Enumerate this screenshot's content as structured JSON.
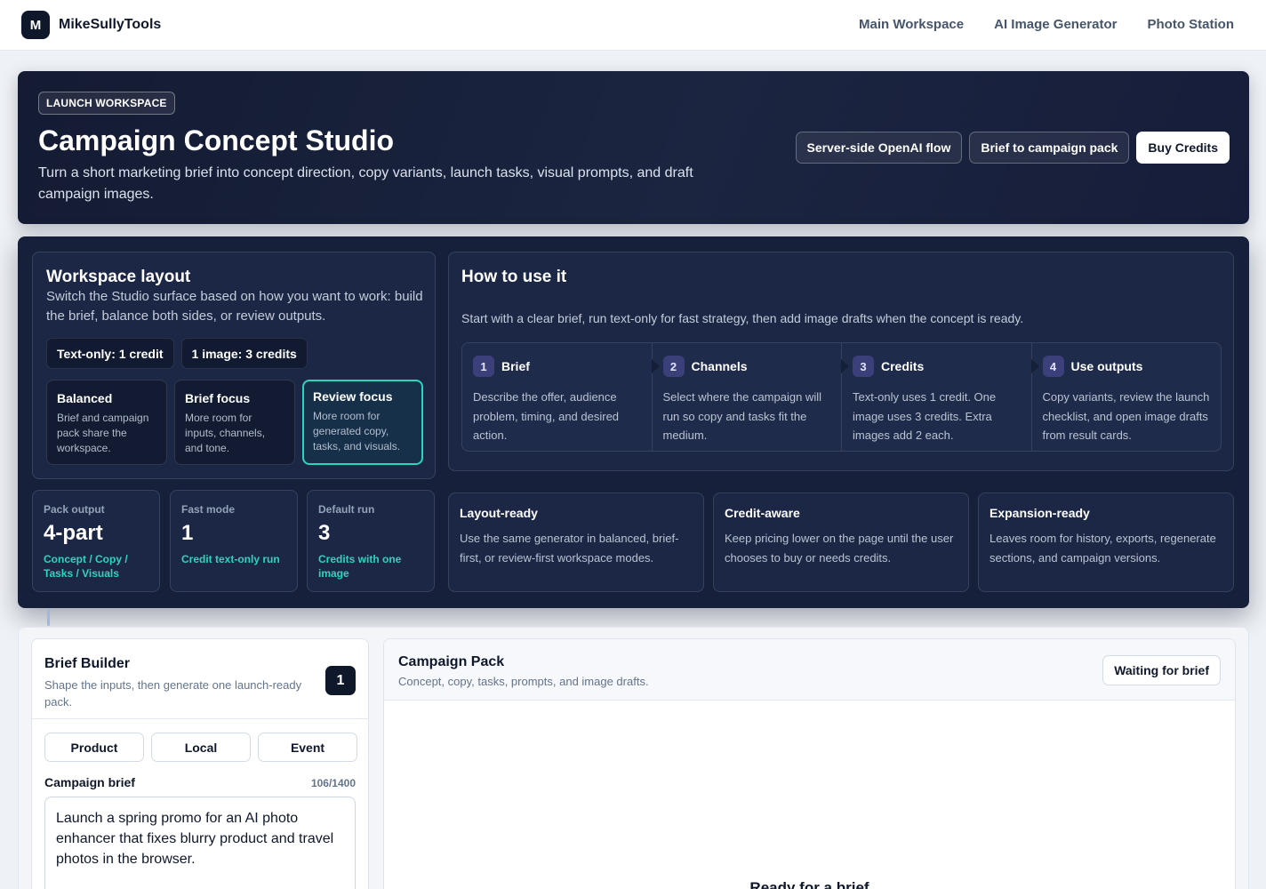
{
  "nav": {
    "brand_mark": "M",
    "brand_name": "MikeSullyTools",
    "links": [
      "Main Workspace",
      "AI Image Generator",
      "Photo Station"
    ]
  },
  "hero": {
    "eyebrow": "LAUNCH WORKSPACE",
    "title": "Campaign Concept Studio",
    "subtitle": "Turn a short marketing brief into concept direction, copy variants, launch tasks, visual prompts, and draft campaign images.",
    "actions": [
      "Server-side OpenAI flow",
      "Brief to campaign pack",
      "Buy Credits"
    ]
  },
  "layout": {
    "title": "Workspace layout",
    "description": "Switch the Studio surface based on how you want to work: build the brief, balance both sides, or review outputs.",
    "pricing": [
      "Text-only: 1 credit",
      "1 image: 3 credits"
    ],
    "modes": [
      {
        "title": "Balanced",
        "desc": "Brief and campaign pack share the workspace."
      },
      {
        "title": "Brief focus",
        "desc": "More room for inputs, channels, and tone."
      },
      {
        "title": "Review focus",
        "desc": "More room for generated copy, tasks, and visuals."
      }
    ],
    "active_mode": "Review focus"
  },
  "howto": {
    "title": "How to use it",
    "description": "Start with a clear brief, run text-only for fast strategy, then add image drafts when the concept is ready.",
    "steps": [
      {
        "num": "1",
        "title": "Brief",
        "desc": "Describe the offer, audience problem, timing, and desired action."
      },
      {
        "num": "2",
        "title": "Channels",
        "desc": "Select where the campaign will run so copy and tasks fit the medium."
      },
      {
        "num": "3",
        "title": "Credits",
        "desc": "Text-only uses 1 credit. One image uses 3 credits. Extra images add 2 each."
      },
      {
        "num": "4",
        "title": "Use outputs",
        "desc": "Copy variants, review the launch checklist, and open image drafts from result cards."
      }
    ]
  },
  "stats": [
    {
      "label": "Pack output",
      "value": "4-part",
      "note": "Concept / Copy / Tasks / Visuals"
    },
    {
      "label": "Fast mode",
      "value": "1",
      "note": "Credit text-only run"
    },
    {
      "label": "Default run",
      "value": "3",
      "note": "Credits with one image"
    }
  ],
  "features": [
    {
      "title": "Layout-ready",
      "desc": "Use the same generator in balanced, brief-first, or review-first workspace modes."
    },
    {
      "title": "Credit-aware",
      "desc": "Keep pricing lower on the page until the user chooses to buy or needs credits."
    },
    {
      "title": "Expansion-ready",
      "desc": "Leaves room for history, exports, regenerate sections, and campaign versions."
    }
  ],
  "brief": {
    "title": "Brief Builder",
    "subtitle": "Shape the inputs, then generate one launch-ready pack.",
    "step": "1",
    "presets": [
      "Product",
      "Local",
      "Event"
    ],
    "field_label": "Campaign brief",
    "char_count": "106/1400",
    "value": "Launch a spring promo for an AI photo enhancer that fixes blurry product and travel photos in the browser."
  },
  "pack": {
    "title": "Campaign Pack",
    "subtitle": "Concept, copy, tasks, prompts, and image drafts.",
    "status": "Waiting for brief",
    "empty_title": "Ready for a brief"
  },
  "colors": {
    "accent": "#2dd4bf",
    "hero_bg": "#141b33",
    "panel_bg": "#16203a"
  }
}
